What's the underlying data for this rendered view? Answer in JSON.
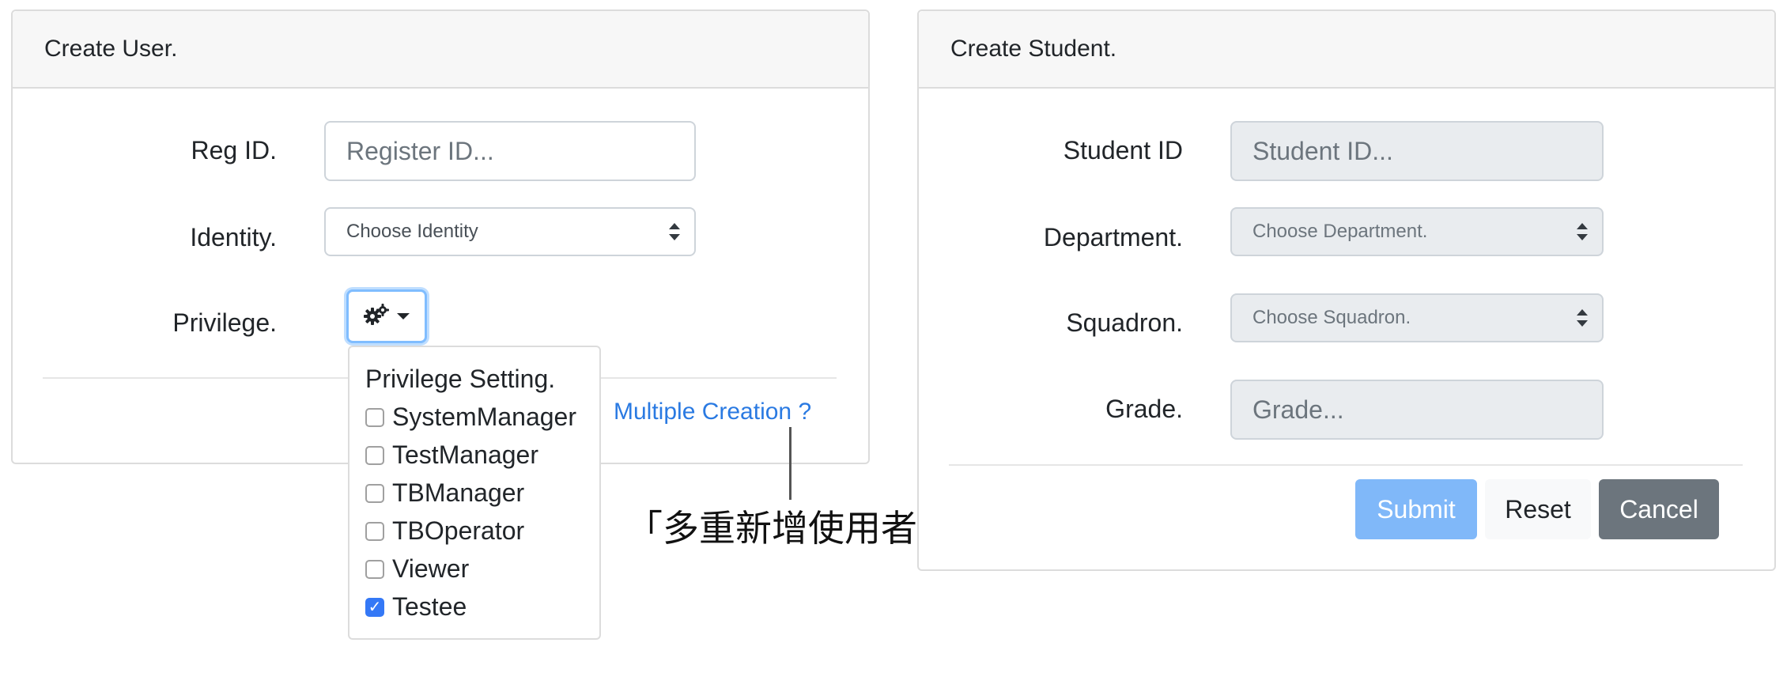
{
  "create_user": {
    "title": "Create User.",
    "reg_id_label": "Reg ID.",
    "reg_id_placeholder": "Register ID...",
    "identity_label": "Identity.",
    "identity_selected": "Choose Identity",
    "privilege_label": "Privilege.",
    "privilege_button_icon": "gears-icon",
    "multiple_creation_link": "Multiple Creation ?",
    "privilege_dropdown": {
      "title": "Privilege Setting.",
      "items": [
        {
          "label": "SystemManager",
          "checked": false
        },
        {
          "label": "TestManager",
          "checked": false
        },
        {
          "label": "TBManager",
          "checked": false
        },
        {
          "label": "TBOperator",
          "checked": false
        },
        {
          "label": "Viewer",
          "checked": false
        },
        {
          "label": "Testee",
          "checked": true
        }
      ]
    }
  },
  "annotation": "「多重新增使用者」",
  "create_student": {
    "title": "Create Student.",
    "student_id_label": "Student ID",
    "student_id_placeholder": "Student ID...",
    "department_label": "Department.",
    "department_selected": "Choose Department.",
    "squadron_label": "Squadron.",
    "squadron_selected": "Choose Squadron.",
    "grade_label": "Grade.",
    "grade_placeholder": "Grade...",
    "submit_label": "Submit",
    "reset_label": "Reset",
    "cancel_label": "Cancel"
  },
  "colors": {
    "link": "#2a7ae2",
    "submit": "#80b8f9",
    "cancel": "#6c757d",
    "checkbox_checked": "#3478f6"
  }
}
